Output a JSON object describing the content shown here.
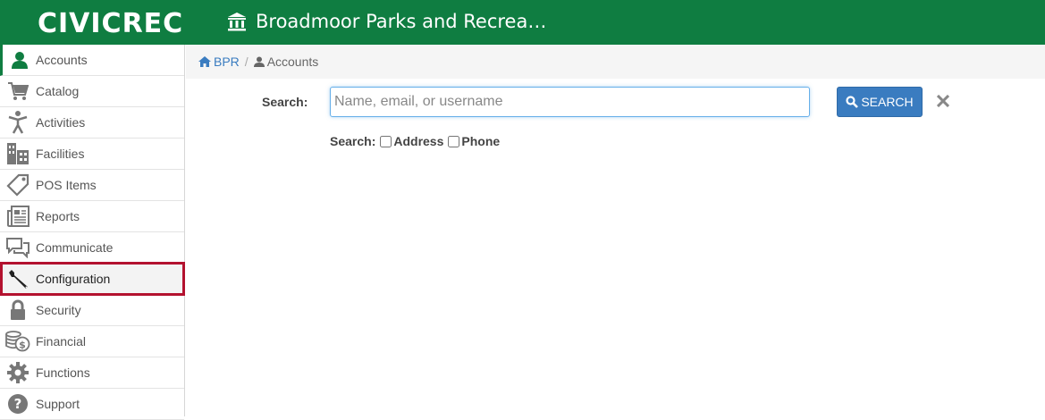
{
  "header": {
    "logo": "CIVICREC",
    "org_name": "Broadmoor Parks and Recrea…",
    "brand_color": "#0f7d41",
    "org_icon": "institution-icon"
  },
  "sidebar": {
    "items": [
      {
        "label": "Accounts",
        "icon": "user-icon"
      },
      {
        "label": "Catalog",
        "icon": "cart-icon"
      },
      {
        "label": "Activities",
        "icon": "person-icon"
      },
      {
        "label": "Facilities",
        "icon": "building-icon"
      },
      {
        "label": "POS Items",
        "icon": "tag-icon"
      },
      {
        "label": "Reports",
        "icon": "newspaper-icon"
      },
      {
        "label": "Communicate",
        "icon": "chat-icon"
      },
      {
        "label": "Configuration",
        "icon": "wrench-icon"
      },
      {
        "label": "Security",
        "icon": "lock-icon"
      },
      {
        "label": "Financial",
        "icon": "coins-icon"
      },
      {
        "label": "Functions",
        "icon": "gear-icon"
      },
      {
        "label": "Support",
        "icon": "question-icon"
      }
    ],
    "active": "Accounts",
    "highlighted": "Configuration",
    "highlight_color": "#b3122f"
  },
  "breadcrumb": {
    "home": "BPR",
    "separator": "/",
    "current": "Accounts"
  },
  "search": {
    "label": "Search:",
    "placeholder": "Name, email, or username",
    "value": "",
    "button_label": "SEARCH",
    "options_label": "Search:",
    "options": [
      {
        "label": "Address",
        "checked": false
      },
      {
        "label": "Phone",
        "checked": false
      }
    ]
  }
}
